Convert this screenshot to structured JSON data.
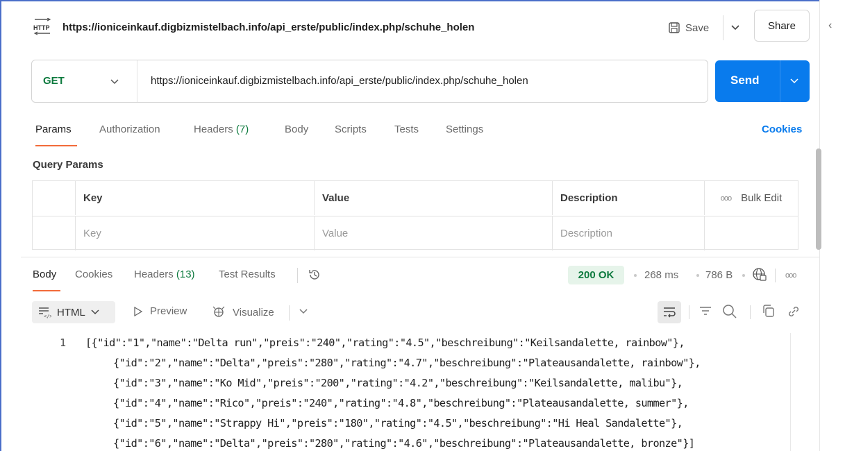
{
  "request": {
    "title": "https://ioniceinkauf.digbizmistelbach.info/api_erste/public/index.php/schuhe_holen",
    "save_label": "Save",
    "share_label": "Share",
    "method": "GET",
    "url": "https://ioniceinkauf.digbizmistelbach.info/api_erste/public/index.php/schuhe_holen",
    "send_label": "Send"
  },
  "request_tabs": {
    "params": "Params",
    "authorization": "Authorization",
    "headers": "Headers",
    "headers_count": "(7)",
    "body": "Body",
    "scripts": "Scripts",
    "tests": "Tests",
    "settings": "Settings",
    "cookies": "Cookies"
  },
  "query_params": {
    "title": "Query Params",
    "headers": {
      "key": "Key",
      "value": "Value",
      "description": "Description",
      "bulk_edit": "Bulk Edit"
    },
    "placeholders": {
      "key": "Key",
      "value": "Value",
      "description": "Description"
    }
  },
  "response_tabs": {
    "body": "Body",
    "cookies": "Cookies",
    "headers": "Headers",
    "headers_count": "(13)",
    "test_results": "Test Results"
  },
  "response_meta": {
    "status": "200 OK",
    "time": "268 ms",
    "size": "786 B"
  },
  "response_toolbar": {
    "format": "HTML",
    "preview": "Preview",
    "visualize": "Visualize"
  },
  "response_body": {
    "line_number": "1",
    "lines": [
      "[{\"id\":\"1\",\"name\":\"Delta run\",\"preis\":\"240\",\"rating\":\"4.5\",\"beschreibung\":\"Keilsandalette, rainbow\"},",
      "{\"id\":\"2\",\"name\":\"Delta\",\"preis\":\"280\",\"rating\":\"4.7\",\"beschreibung\":\"Plateausandalette, rainbow\"},",
      "{\"id\":\"3\",\"name\":\"Ko Mid\",\"preis\":\"200\",\"rating\":\"4.2\",\"beschreibung\":\"Keilsandalette, malibu\"},",
      "{\"id\":\"4\",\"name\":\"Rico\",\"preis\":\"240\",\"rating\":\"4.8\",\"beschreibung\":\"Plateausandalette, summer\"},",
      "{\"id\":\"5\",\"name\":\"Strappy Hi\",\"preis\":\"180\",\"rating\":\"4.5\",\"beschreibung\":\"Hi Heal Sandalette\"},",
      "{\"id\":\"6\",\"name\":\"Delta\",\"preis\":\"280\",\"rating\":\"4.6\",\"beschreibung\":\"Plateausandalette, bronze\"}]"
    ]
  },
  "colors": {
    "accent_blue": "#097bed",
    "method_green": "#0d7a3e",
    "tab_underline": "#f26b3a",
    "status_bg": "#e6f4ea"
  },
  "icons": [
    "http-icon",
    "save-icon",
    "chevron-down-icon",
    "history-icon",
    "globe-icon",
    "more-icon",
    "word-wrap-icon",
    "filter-icon",
    "search-icon",
    "copy-icon",
    "link-icon",
    "eye-icon",
    "visualize-icon",
    "format-icon"
  ]
}
